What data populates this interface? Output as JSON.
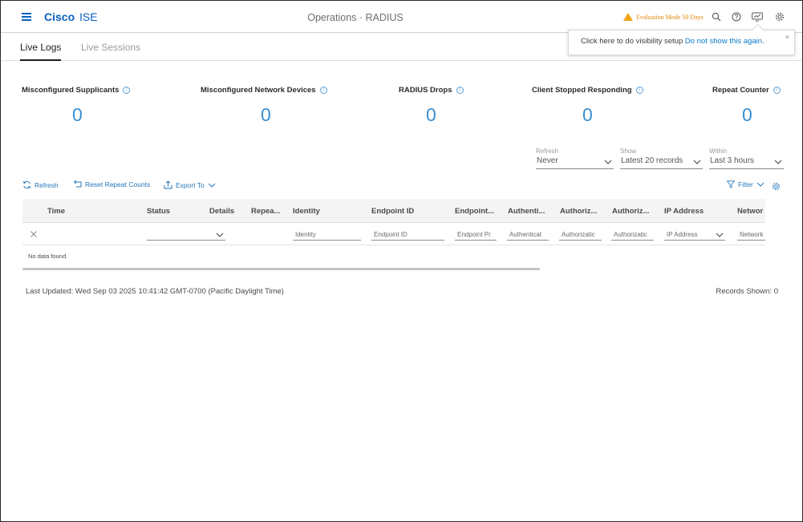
{
  "header": {
    "brand_bold": "Cisco",
    "brand_product": "ISE",
    "page_title": "Operations · RADIUS",
    "eval_text": "Evaluation Mode 50 Days"
  },
  "tabs": [
    {
      "label": "Live Logs",
      "active": true
    },
    {
      "label": "Live Sessions",
      "active": false
    }
  ],
  "tooltip": {
    "text": "Click here to do visibility setup",
    "link": "Do not show this again.",
    "close": "×"
  },
  "counters": [
    {
      "label": "Misconfigured Supplicants",
      "value": "0"
    },
    {
      "label": "Misconfigured Network Devices",
      "value": "0"
    },
    {
      "label": "RADIUS Drops",
      "value": "0"
    },
    {
      "label": "Client Stopped Responding",
      "value": "0"
    },
    {
      "label": "Repeat Counter",
      "value": "0"
    }
  ],
  "filters": {
    "refresh": {
      "label": "Refresh",
      "value": "Never"
    },
    "show": {
      "label": "Show",
      "value": "Latest 20 records"
    },
    "within": {
      "label": "Within",
      "value": "Last 3 hours"
    }
  },
  "toolbar": {
    "refresh": "Refresh",
    "reset": "Reset Repeat Counts",
    "export": "Export To",
    "filter": "Filter"
  },
  "table": {
    "columns": [
      "Time",
      "Status",
      "Details",
      "Repea...",
      "Identity",
      "Endpoint ID",
      "Endpoint...",
      "Authenti...",
      "Authoriz...",
      "Authoriz...",
      "IP Address",
      "Networ"
    ],
    "filter_placeholders": [
      "Identity",
      "Endpoint ID",
      "Endpoint Pr",
      "Authenticat",
      "Authorizatic",
      "Authorizatic",
      "IP Address",
      "Network"
    ],
    "empty_text": "No data found."
  },
  "footer": {
    "last_updated": "Last Updated: Wed Sep 03 2025 10:41:42 GMT-0700 (Pacific Daylight Time)",
    "records_shown": "Records Shown: 0"
  },
  "colors": {
    "brand": "#0a60c2",
    "counter": "#3a8fd1",
    "warning": "#e4860a",
    "link": "#2676b9"
  },
  "icons": [
    "hamburger-icon",
    "warning-icon",
    "search-icon",
    "help-icon",
    "notification-icon",
    "gear-icon",
    "info-icon",
    "refresh-icon",
    "reset-icon",
    "export-icon",
    "filter-icon",
    "settings-icon",
    "chevron-down-icon",
    "clear-icon"
  ]
}
